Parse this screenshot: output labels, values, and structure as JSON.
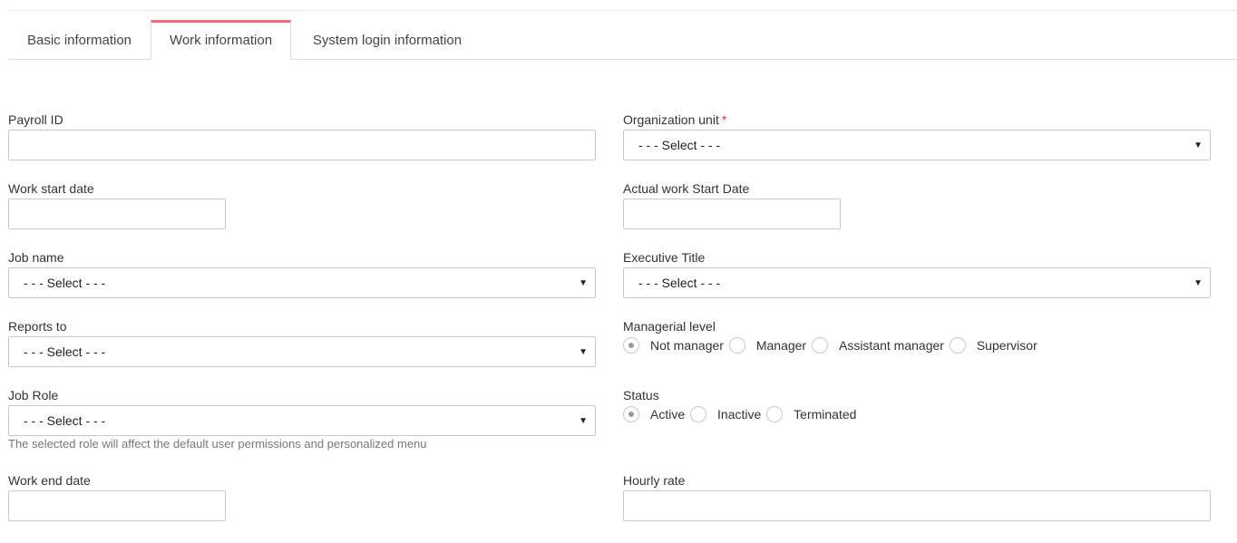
{
  "tabs": [
    {
      "label": "Basic information"
    },
    {
      "label": "Work information"
    },
    {
      "label": "System login information"
    }
  ],
  "active_tab": "Work information",
  "accent_color": "#e57373",
  "form": {
    "payroll_id": {
      "label": "Payroll ID",
      "value": ""
    },
    "organization_unit": {
      "label": "Organization unit",
      "required_mark": "*",
      "value": "- - - Select - - -"
    },
    "work_start_date": {
      "label": "Work start date",
      "value": ""
    },
    "actual_work_start_date": {
      "label": "Actual work Start Date",
      "value": ""
    },
    "job_name": {
      "label": "Job name",
      "value": "- - - Select - - -"
    },
    "executive_title": {
      "label": "Executive Title",
      "value": "- - - Select - - -"
    },
    "reports_to": {
      "label": "Reports to",
      "value": "- - - Select - - -"
    },
    "managerial_level": {
      "label": "Managerial level",
      "options": [
        "Not manager",
        "Manager",
        "Assistant manager",
        "Supervisor"
      ],
      "selected": "Not manager"
    },
    "job_role": {
      "label": "Job Role",
      "value": "- - - Select - - -",
      "help": "The selected role will affect the default user permissions and personalized menu"
    },
    "status": {
      "label": "Status",
      "options": [
        "Active",
        "Inactive",
        "Terminated"
      ],
      "selected": "Active"
    },
    "work_end_date": {
      "label": "Work end date",
      "value": ""
    },
    "hourly_rate": {
      "label": "Hourly rate",
      "value": ""
    }
  },
  "icons": {
    "dropdown": "caret-down-icon",
    "caret_glyph": "▼"
  }
}
